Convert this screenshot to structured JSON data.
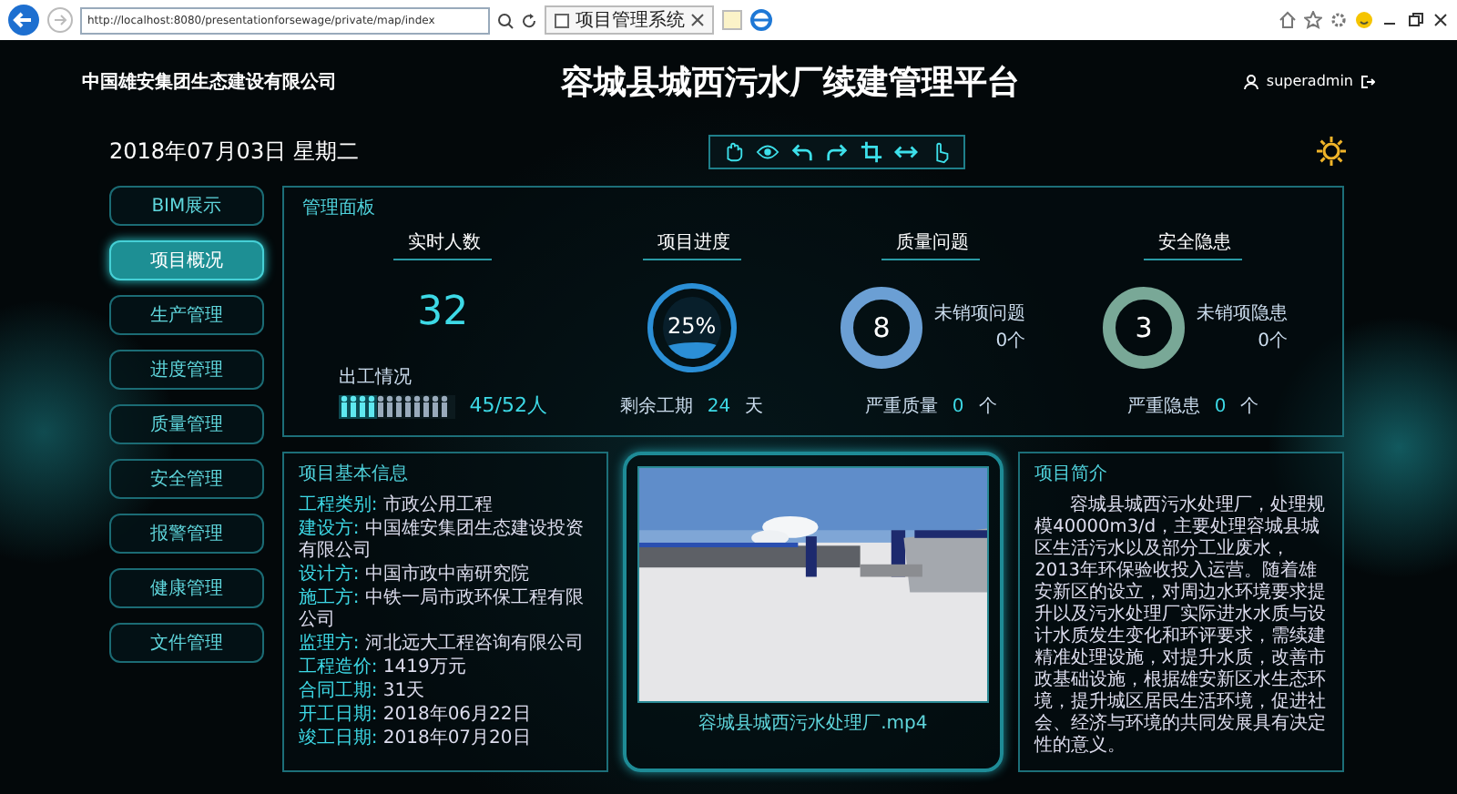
{
  "browser": {
    "address": "http://localhost:8080/presentationforsewage/private/map/index",
    "tab": "项目管理系统"
  },
  "header": {
    "company": "中国雄安集团生态建设有限公司",
    "title": "容城县城西污水厂续建管理平台",
    "user": "superadmin",
    "date": "2018年07月03日  星期二"
  },
  "nav": [
    {
      "label": "BIM展示",
      "selected": false
    },
    {
      "label": "项目概况",
      "selected": true
    },
    {
      "label": "生产管理",
      "selected": false
    },
    {
      "label": "进度管理",
      "selected": false
    },
    {
      "label": "质量管理",
      "selected": false
    },
    {
      "label": "安全管理",
      "selected": false
    },
    {
      "label": "报警管理",
      "selected": false
    },
    {
      "label": "健康管理",
      "selected": false
    },
    {
      "label": "文件管理",
      "selected": false
    }
  ],
  "dashboard": {
    "title": "管理面板",
    "workers": {
      "title": "实时人数",
      "count": "32",
      "attendance_label": "出工情况",
      "level": 0.33,
      "attendance": "45/52",
      "unit": "人"
    },
    "progress": {
      "title": "项目进度",
      "level": 0.25,
      "percent": "25%",
      "remaining_label": "剩余工期",
      "remaining": "24",
      "unit": "天"
    },
    "issues": [
      {
        "title": "质量问题",
        "count": "8",
        "color": "#6b9fd4",
        "open_label": "未销项问题",
        "open": "0个",
        "severe_label": "严重质量",
        "severe": "0",
        "unit": "个"
      },
      {
        "title": "安全隐患",
        "count": "3",
        "color": "#79a897",
        "open_label": "未销项隐患",
        "open": "0个",
        "severe_label": "严重隐患",
        "severe": "0",
        "unit": "个"
      }
    ]
  },
  "info": {
    "title": "项目基本信息",
    "fields": [
      {
        "label": "工程类别:",
        "value": "市政公用工程"
      },
      {
        "label": "建设方:",
        "value": "中国雄安集团生态建设投资有限公司"
      },
      {
        "label": "设计方:",
        "value": "中国市政中南研究院"
      },
      {
        "label": "施工方:",
        "value": "中铁一局市政环保工程有限公司"
      },
      {
        "label": "监理方:",
        "value": "河北远大工程咨询有限公司"
      },
      {
        "label": "工程造价:",
        "value": "1419万元"
      },
      {
        "label": "合同工期:",
        "value": "31天"
      },
      {
        "label": "开工日期:",
        "value": "2018年06月22日"
      },
      {
        "label": "竣工日期:",
        "value": "2018年07月20日"
      }
    ]
  },
  "video": {
    "caption": "容城县城西污水处理厂.mp4"
  },
  "intro": {
    "title": "项目简介",
    "text": "容城县城西污水处理厂，处理规模40000m3/d，主要处理容城县城区生活污水以及部分工业废水，2013年环保验收投入运营。随着雄安新区的设立，对周边水环境要求提升以及污水处理厂实际进水水质与设计水质发生变化和环评要求，需续建精准处理设施，对提升水质，改善市政基础设施，根据雄安新区水生态环境，提升城区居民生活环境，促进社会、经济与环境的共同发展具有决定性的意义。"
  }
}
